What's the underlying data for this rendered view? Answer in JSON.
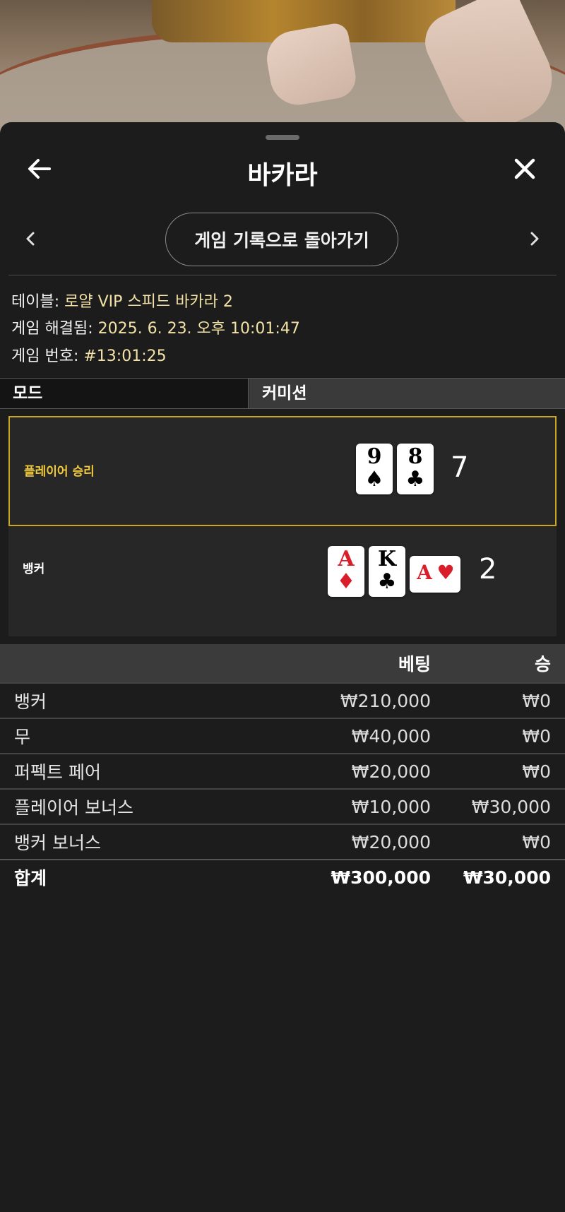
{
  "header": {
    "title": "바카라",
    "back_icon": "arrow-left-icon",
    "close_icon": "close-icon"
  },
  "nav": {
    "history_button": "게임 기록으로 돌아가기"
  },
  "info": {
    "table_label": "테이블: ",
    "table_value": "로얄 VIP 스피드 바카라 2",
    "resolved_label": "게임 해결됨: ",
    "resolved_value": "2025. 6. 23. 오후 10:01:47",
    "number_label": "게임 번호: ",
    "number_value": "#13:01:25"
  },
  "mode": {
    "left": "모드",
    "right": "커미션"
  },
  "results": {
    "player": {
      "label": "플레이어 승리",
      "score": "7",
      "label_color": "#f0c93a",
      "cards": [
        {
          "rank": "9",
          "suit": "♠"
        },
        {
          "rank": "8",
          "suit": "♣"
        }
      ]
    },
    "banker": {
      "label": "뱅커",
      "score": "2",
      "cards": [
        {
          "rank": "A",
          "suit": "♦"
        },
        {
          "rank": "K",
          "suit": "♣"
        },
        {
          "rank": "A",
          "suit": "♥"
        }
      ]
    }
  },
  "bets_table": {
    "headers": {
      "bet": "베팅",
      "win": "승"
    },
    "rows": [
      {
        "name": "뱅커",
        "bet": "₩210,000",
        "win": "₩0"
      },
      {
        "name": "무",
        "bet": "₩40,000",
        "win": "₩0"
      },
      {
        "name": "퍼펙트 페어",
        "bet": "₩20,000",
        "win": "₩0"
      },
      {
        "name": "플레이어 보너스",
        "bet": "₩10,000",
        "win": "₩30,000"
      },
      {
        "name": "뱅커 보너스",
        "bet": "₩20,000",
        "win": "₩0"
      }
    ],
    "total": {
      "name": "합계",
      "bet": "₩300,000",
      "win": "₩30,000"
    }
  }
}
